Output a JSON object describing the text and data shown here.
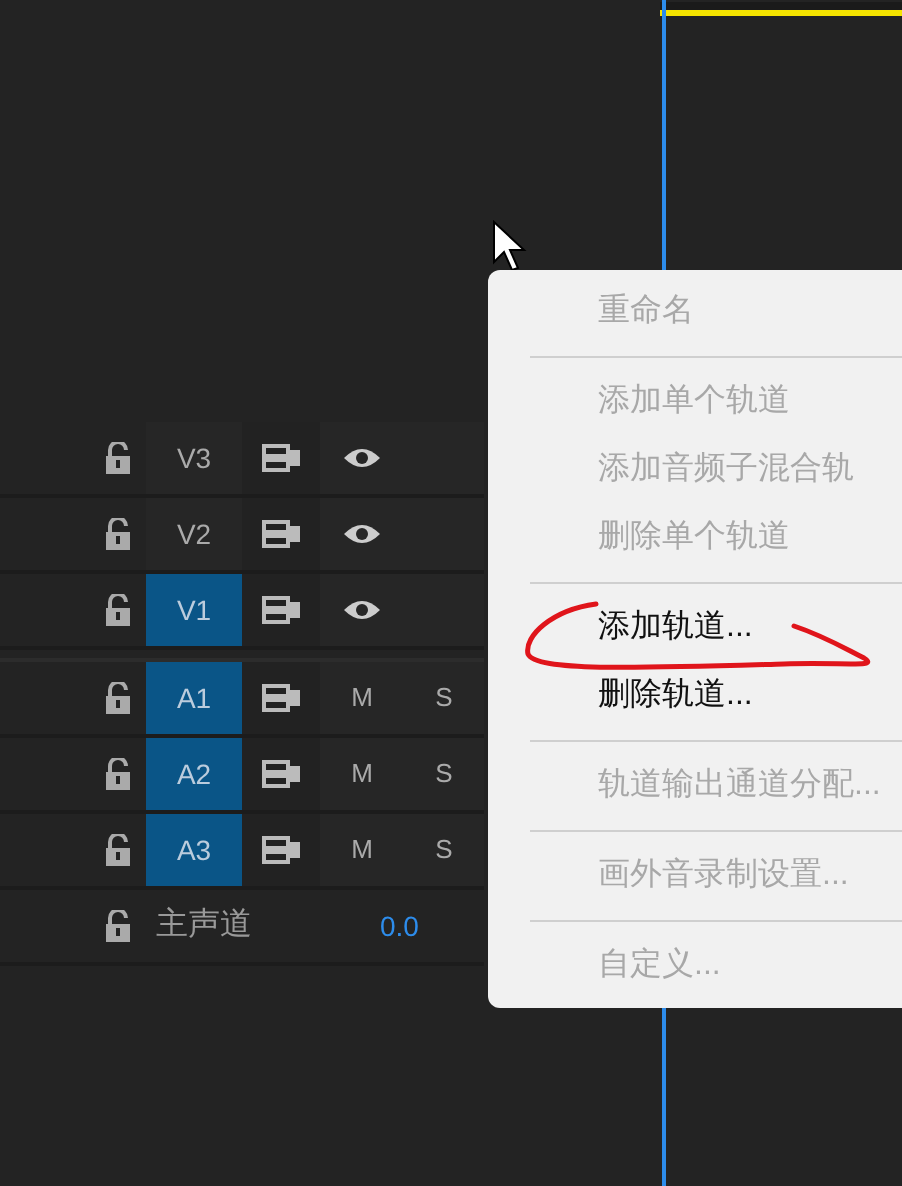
{
  "video_tracks": [
    {
      "label": "V3",
      "targeted": false
    },
    {
      "label": "V2",
      "targeted": false
    },
    {
      "label": "V1",
      "targeted": true
    }
  ],
  "audio_tracks": [
    {
      "label": "A1",
      "targeted": true,
      "mute": "M",
      "solo": "S"
    },
    {
      "label": "A2",
      "targeted": true,
      "mute": "M",
      "solo": "S"
    },
    {
      "label": "A3",
      "targeted": true,
      "mute": "M",
      "solo": "S"
    }
  ],
  "master_track": {
    "label": "主声道",
    "value": "0.0"
  },
  "context_menu": [
    {
      "kind": "item",
      "label": "重命名",
      "disabled": true
    },
    {
      "kind": "separator"
    },
    {
      "kind": "item",
      "label": "添加单个轨道",
      "disabled": true
    },
    {
      "kind": "item",
      "label": "添加音频子混合轨",
      "disabled": true
    },
    {
      "kind": "item",
      "label": "删除单个轨道",
      "disabled": true
    },
    {
      "kind": "separator"
    },
    {
      "kind": "item",
      "label": "添加轨道...",
      "disabled": false
    },
    {
      "kind": "item",
      "label": "删除轨道...",
      "disabled": false
    },
    {
      "kind": "separator"
    },
    {
      "kind": "item",
      "label": "轨道输出通道分配...",
      "disabled": true
    },
    {
      "kind": "separator"
    },
    {
      "kind": "item",
      "label": "画外音录制设置...",
      "disabled": true
    },
    {
      "kind": "separator"
    },
    {
      "kind": "item",
      "label": "自定义...",
      "disabled": true
    }
  ]
}
